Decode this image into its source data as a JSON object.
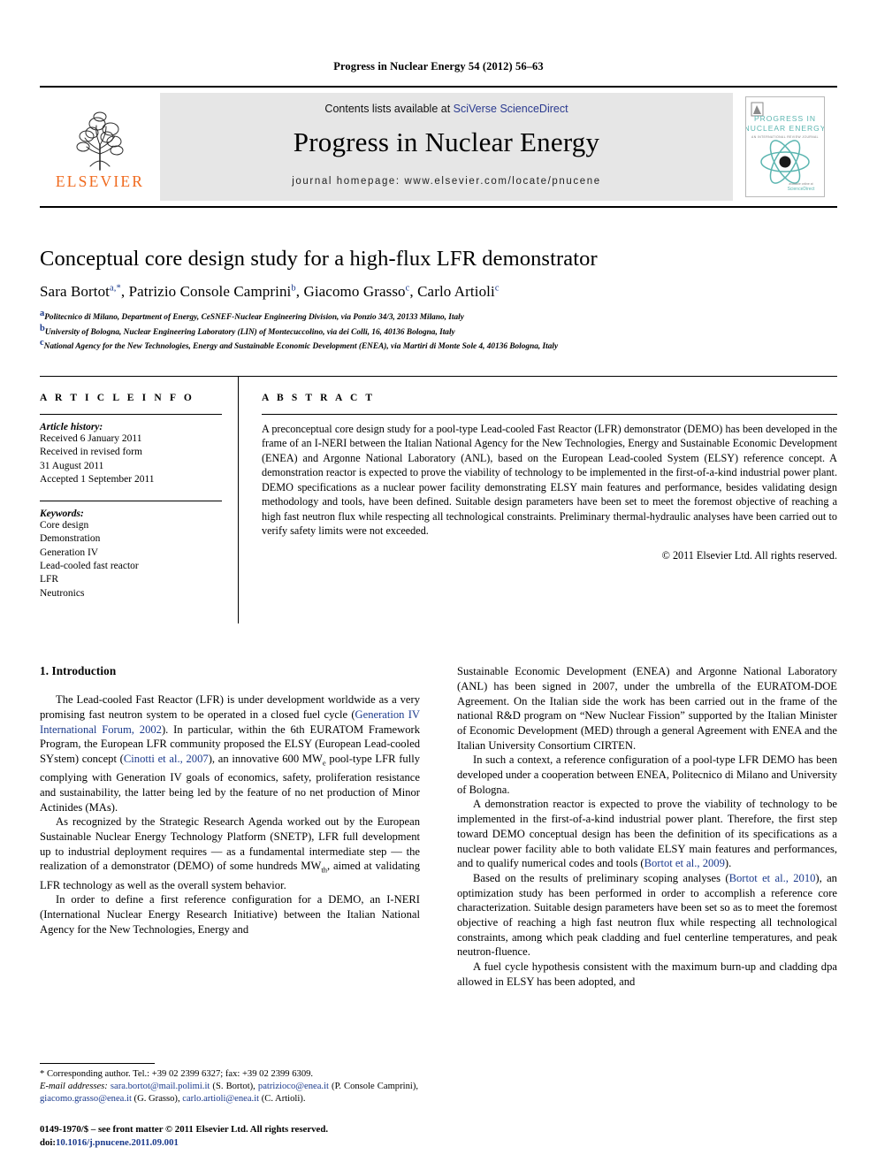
{
  "running_head": "Progress in Nuclear Energy 54 (2012) 56–63",
  "masthead": {
    "publisher_name": "ELSEVIER",
    "contents_prefix": "Contents lists available at ",
    "contents_link": "SciVerse ScienceDirect",
    "journal_title": "Progress in Nuclear Energy",
    "homepage": "journal homepage: www.elsevier.com/locate/pnucene",
    "cover": {
      "line1": "PROGRESS IN",
      "line2": "NUCLEAR ENERGY",
      "line3": "AN INTERNATIONAL REVIEW JOURNAL",
      "footer": "ScienceDirect",
      "accent": "#5bb5b0"
    }
  },
  "article": {
    "title": "Conceptual core design study for a high-flux LFR demonstrator",
    "authors": [
      {
        "name": "Sara Bortot",
        "marks": "a,*"
      },
      {
        "name": "Patrizio Console Camprini",
        "marks": "b"
      },
      {
        "name": "Giacomo Grasso",
        "marks": "c"
      },
      {
        "name": "Carlo Artioli",
        "marks": "c"
      }
    ],
    "affiliations": [
      {
        "mark": "a",
        "text": "Politecnico di Milano, Department of Energy, CeSNEF-Nuclear Engineering Division, via Ponzio 34/3, 20133 Milano, Italy"
      },
      {
        "mark": "b",
        "text": "University of Bologna, Nuclear Engineering Laboratory (LIN) of Montecuccolino, via dei Colli, 16, 40136 Bologna, Italy"
      },
      {
        "mark": "c",
        "text": "National Agency for the New Technologies, Energy and Sustainable Economic Development (ENEA), via Martiri di Monte Sole 4, 40136 Bologna, Italy"
      }
    ]
  },
  "article_info": {
    "heading": "A R T I C L E  I N F O",
    "history_label": "Article history:",
    "history": [
      "Received 6 January 2011",
      "Received in revised form",
      "31 August 2011",
      "Accepted 1 September 2011"
    ],
    "keywords_label": "Keywords:",
    "keywords": [
      "Core design",
      "Demonstration",
      "Generation IV",
      "Lead-cooled fast reactor",
      "LFR",
      "Neutronics"
    ]
  },
  "abstract": {
    "heading": "A B S T R A C T",
    "text": "A preconceptual core design study for a pool-type Lead-cooled Fast Reactor (LFR) demonstrator (DEMO) has been developed in the frame of an I-NERI between the Italian National Agency for the New Technologies, Energy and Sustainable Economic Development (ENEA) and Argonne National Laboratory (ANL), based on the European Lead-cooled System (ELSY) reference concept. A demonstration reactor is expected to prove the viability of technology to be implemented in the first-of-a-kind industrial power plant. DEMO specifications as a nuclear power facility demonstrating ELSY main features and performance, besides validating design methodology and tools, have been defined. Suitable design parameters have been set to meet the foremost objective of reaching a high fast neutron flux while respecting all technological constraints. Preliminary thermal-hydraulic analyses have been carried out to verify safety limits were not exceeded.",
    "copyright": "© 2011 Elsevier Ltd. All rights reserved."
  },
  "introduction": {
    "section_number_title": "1. Introduction",
    "left_paragraphs": [
      {
        "parts": [
          {
            "t": "The Lead-cooled Fast Reactor (LFR) is under development worldwide as a very promising fast neutron system to be operated in a closed fuel cycle (",
            "ref": false
          },
          {
            "t": "Generation IV International Forum, 2002",
            "ref": true
          },
          {
            "t": "). In particular, within the 6th EURATOM Framework Program, the European LFR community proposed the ELSY (European Lead-cooled SYstem) concept (",
            "ref": false
          },
          {
            "t": "Cinotti et al., 2007",
            "ref": true
          },
          {
            "t": "), an innovative 600 MW<sub>e</sub> pool-type LFR fully complying with Generation IV goals of economics, safety, proliferation resistance and sustainability, the latter being led by the feature of no net production of Minor Actinides (MAs).",
            "ref": false
          }
        ]
      },
      {
        "parts": [
          {
            "t": "As recognized by the Strategic Research Agenda worked out by the European Sustainable Nuclear Energy Technology Platform (SNETP), LFR full development up to industrial deployment requires — as a fundamental intermediate step — the realization of a demonstrator (DEMO) of some hundreds MW<sub>th</sub>, aimed at validating LFR technology as well as the overall system behavior.",
            "ref": false
          }
        ]
      },
      {
        "parts": [
          {
            "t": "In order to define a first reference configuration for a DEMO, an I-NERI (International Nuclear Energy Research Initiative) between the Italian National Agency for the New Technologies, Energy and",
            "ref": false
          }
        ]
      }
    ],
    "right_paragraphs": [
      {
        "parts": [
          {
            "t": "Sustainable Economic Development (ENEA) and Argonne National Laboratory (ANL) has been signed in 2007, under the umbrella of the EURATOM-DOE Agreement. On the Italian side the work has been carried out in the frame of the national R&D program on “New Nuclear Fission” supported by the Italian Minister of Economic Development (MED) through a general Agreement with ENEA and the Italian University Consortium CIRTEN.",
            "ref": false
          }
        ],
        "indent": false
      },
      {
        "parts": [
          {
            "t": "In such a context, a reference configuration of a pool-type LFR DEMO has been developed under a cooperation between ENEA, Politecnico di Milano and University of Bologna.",
            "ref": false
          }
        ],
        "indent": true
      },
      {
        "parts": [
          {
            "t": "A demonstration reactor is expected to prove the viability of technology to be implemented in the first-of-a-kind industrial power plant. Therefore, the first step toward DEMO conceptual design has been the definition of its specifications as a nuclear power facility able to both validate ELSY main features and performances, and to qualify numerical codes and tools (",
            "ref": false
          },
          {
            "t": "Bortot et al., 2009",
            "ref": true
          },
          {
            "t": ").",
            "ref": false
          }
        ],
        "indent": true
      },
      {
        "parts": [
          {
            "t": "Based on the results of preliminary scoping analyses (",
            "ref": false
          },
          {
            "t": "Bortot et al., 2010",
            "ref": true
          },
          {
            "t": "), an optimization study has been performed in order to accomplish a reference core characterization. Suitable design parameters have been set so as to meet the foremost objective of reaching a high fast neutron flux while respecting all technological constraints, among which peak cladding and fuel centerline temperatures, and peak neutron-fluence.",
            "ref": false
          }
        ],
        "indent": true
      },
      {
        "parts": [
          {
            "t": "A fuel cycle hypothesis consistent with the maximum burn-up and cladding dpa allowed in ELSY has been adopted, and",
            "ref": false
          }
        ],
        "indent": true
      }
    ]
  },
  "footnotes": {
    "corresponding": "* Corresponding author. Tel.: +39 02 2399 6327; fax: +39 02 2399 6309.",
    "email_label": "E-mail addresses:",
    "emails": [
      {
        "address": "sara.bortot@mail.polimi.it",
        "who": "(S. Bortot)"
      },
      {
        "address": "patrizioco@enea.it",
        "who": "(P. Console Camprini)"
      },
      {
        "address": "giacomo.grasso@enea.it",
        "who": "(G. Grasso)"
      },
      {
        "address": "carlo.artioli@enea.it",
        "who": "(C. Artioli)"
      }
    ]
  },
  "imprint": {
    "line1": "0149-1970/$ – see front matter © 2011 Elsevier Ltd. All rights reserved.",
    "doi_label": "doi:",
    "doi": "10.1016/j.pnucene.2011.09.001"
  }
}
